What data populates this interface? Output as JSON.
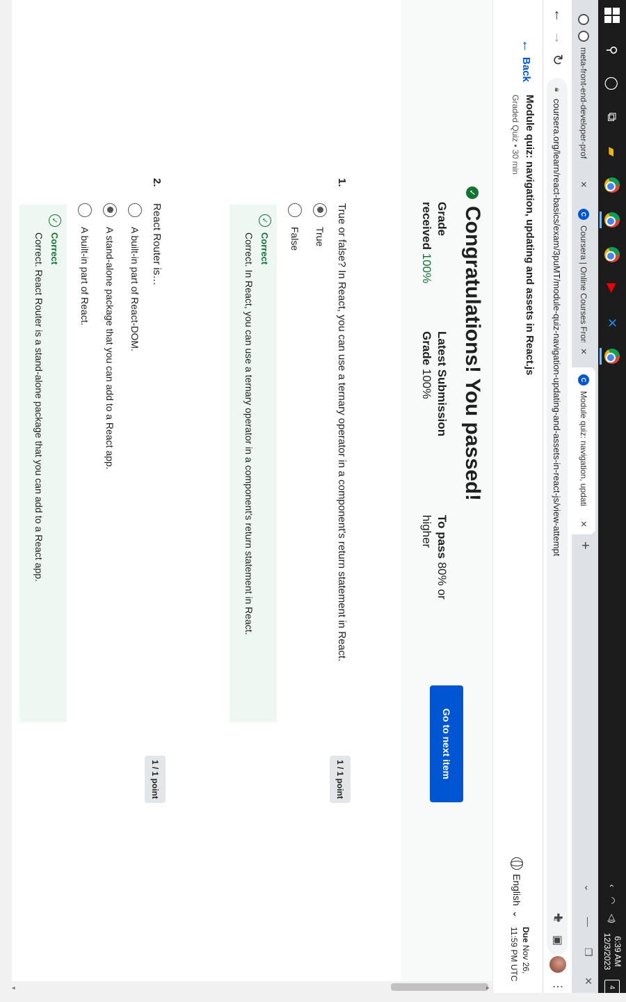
{
  "taskbar": {
    "time": "6:39 AM",
    "date": "12/3/2023",
    "notifications": "4"
  },
  "tabs": [
    {
      "title": "meta-front-end-developer-prof",
      "close": "✕"
    },
    {
      "title": "Coursera | Online Courses From",
      "close": "✕"
    },
    {
      "title": "Module quiz: navigation, updati",
      "close": "✕"
    }
  ],
  "toolbar": {
    "url": "coursera.org/learn/react-basics/exam/3puMT/module-quiz-navigation-updating-and-assets-in-react-js/view-attempt"
  },
  "header": {
    "back_label": "Back",
    "quiz_title": "Module quiz: navigation, updating and assets in React.js",
    "quiz_subtitle": "Graded Quiz • 30 min",
    "language": "English",
    "due_label": "Due",
    "due_date": "Nov 26,",
    "due_time": "11:59 PM UTC"
  },
  "results": {
    "heading": "Congratulations! You passed!",
    "grade_label": "Grade",
    "received_label": "received",
    "received_value": "100%",
    "latest_label": "Latest Submission",
    "latest_grade_label": "Grade",
    "latest_grade_value": "100%",
    "to_pass_label": "To pass",
    "to_pass_value": "80% or",
    "to_pass_suffix": "higher",
    "next_button": "Go to next item"
  },
  "questions": [
    {
      "number": "1.",
      "text": "True or false? In React, you can use a ternary operator in a component's return statement in React.",
      "points": "1 / 1 point",
      "options": [
        "True",
        "False"
      ],
      "selected": 0,
      "feedback_label": "Correct",
      "feedback_text": "Correct. In React, you can use a ternary operator in a component's return statement in React."
    },
    {
      "number": "2.",
      "text": "React Router is…",
      "points": "1 / 1 point",
      "options": [
        "A built-in part of React-DOM.",
        "A stand-alone package that you can add to a React app.",
        "A built-in part of React."
      ],
      "selected": 1,
      "feedback_label": "Correct",
      "feedback_text": "Correct. React Router is a stand-alone package that you can add to a React app."
    }
  ],
  "colors": {
    "primary": "#0056d2",
    "success": "#137333",
    "feedback_bg": "#eef7f2",
    "results_bg": "#f7faf9"
  }
}
